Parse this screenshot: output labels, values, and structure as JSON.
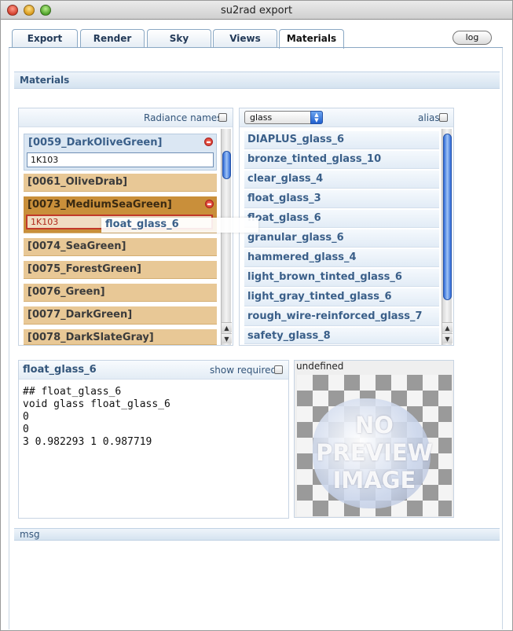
{
  "window": {
    "title": "su2rad export"
  },
  "tabs": [
    {
      "label": "Export",
      "active": false
    },
    {
      "label": "Render",
      "active": false
    },
    {
      "label": "Sky",
      "active": false
    },
    {
      "label": "Views",
      "active": false
    },
    {
      "label": "Materials",
      "active": true
    }
  ],
  "log_button": "log",
  "section_title": "Materials",
  "left_panel": {
    "header_label": "Radiance names",
    "items": [
      {
        "name": "[0059_DarkOliveGreen]",
        "alias": "1K103"
      },
      {
        "name": "[0061_OliveDrab]"
      },
      {
        "name": "[0073_MediumSeaGreen]",
        "alias": "1K103"
      },
      {
        "name": "[0074_SeaGreen]"
      },
      {
        "name": "[0075_ForestGreen]"
      },
      {
        "name": "[0076_Green]"
      },
      {
        "name": "[0077_DarkGreen]"
      },
      {
        "name": "[0078_DarkSlateGray]"
      }
    ]
  },
  "drag_ghost": "float_glass_6",
  "right_panel": {
    "select_value": "glass",
    "alias_label": "alias",
    "items": [
      "DIAPLUS_glass_6",
      "bronze_tinted_glass_10",
      "clear_glass_4",
      "float_glass_3",
      "float_glass_6",
      "granular_glass_6",
      "hammered_glass_4",
      "light_brown_tinted_glass_6",
      "light_gray_tinted_glass_6",
      "rough_wire-reinforced_glass_7",
      "safety_glass_8"
    ]
  },
  "detail_panel": {
    "title": "float_glass_6",
    "show_required_label": "show required",
    "code_lines": [
      "## float_glass_6",
      "void glass float_glass_6",
      "0",
      "0",
      "3 0.982293 1 0.987719"
    ]
  },
  "preview": {
    "label": "undefined",
    "placeholder_line1": "NO",
    "placeholder_line2": "PREVIEW",
    "placeholder_line3": "IMAGE"
  },
  "msg_bar": "msg"
}
